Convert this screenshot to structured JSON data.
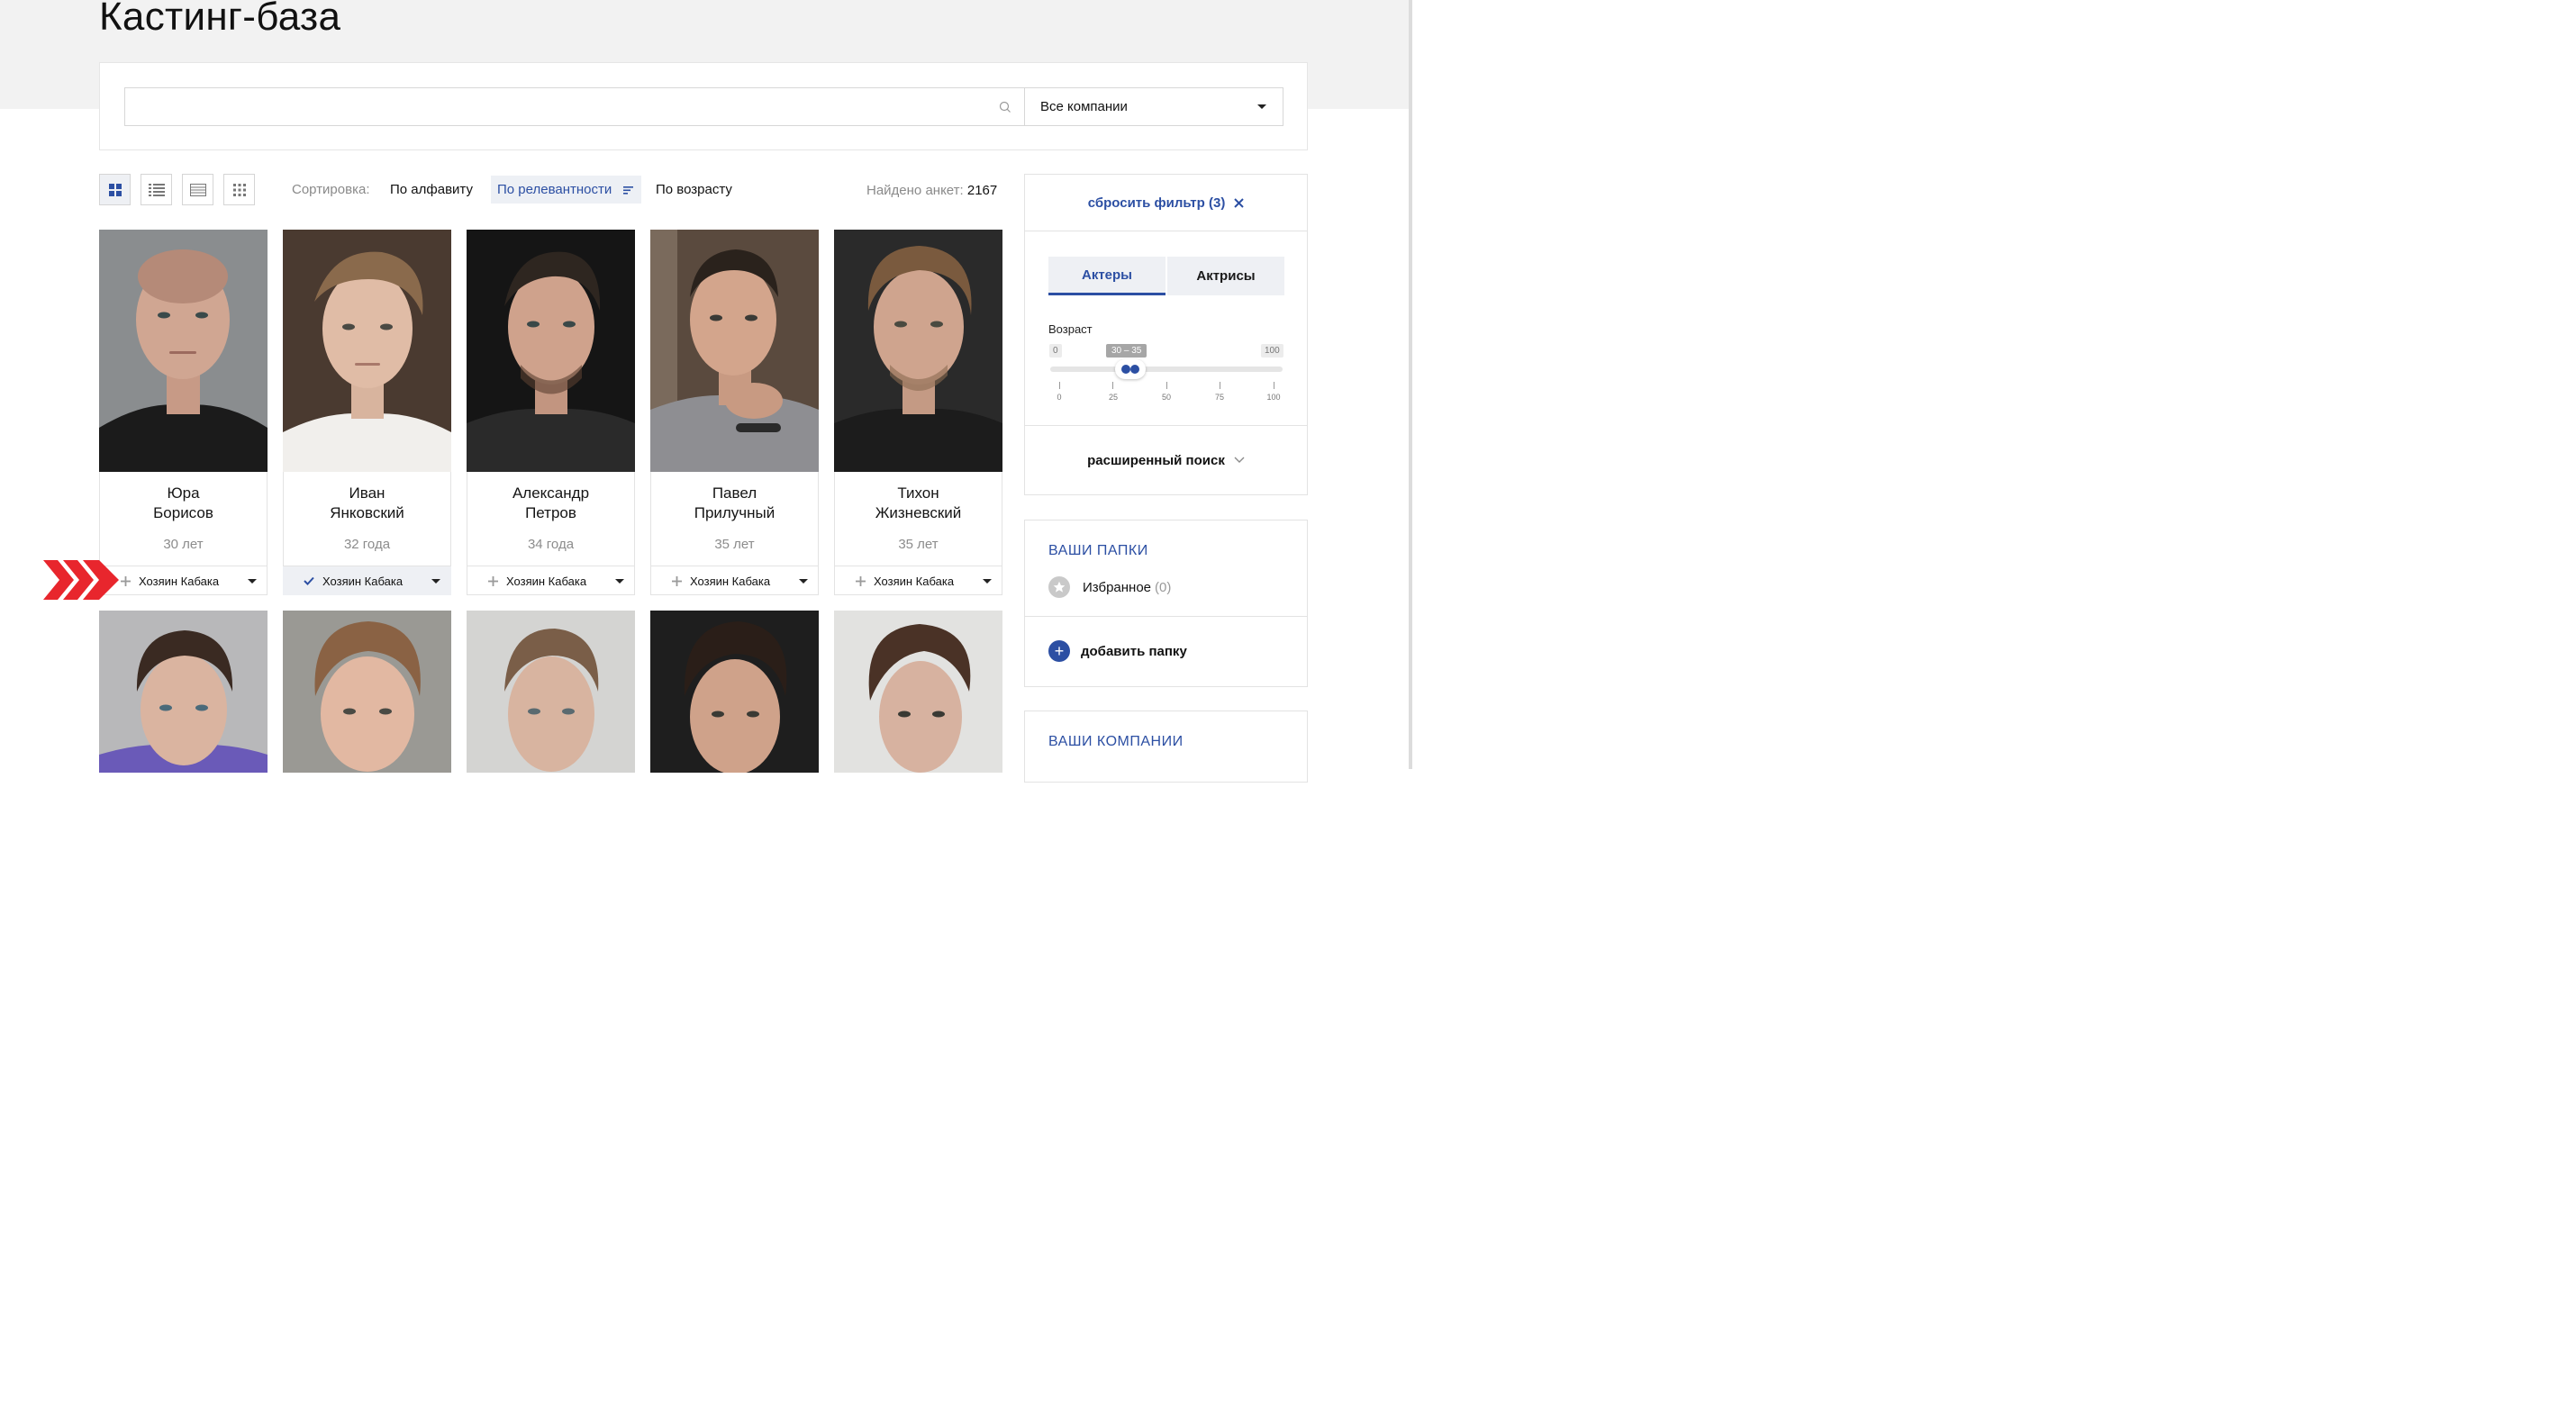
{
  "page": {
    "title": "Кастинг-база"
  },
  "search": {
    "placeholder": "",
    "value": "",
    "company_select": "Все компании"
  },
  "toolbar": {
    "sort_label": "Сортировка:",
    "sort_options": [
      "По алфавиту",
      "По релевантности",
      "По возрасту"
    ],
    "sort_active": "По релевантности",
    "found_label": "Найдено анкет:",
    "found_count": "2167",
    "view_modes": [
      "grid-large-icon",
      "list-icon",
      "table-icon",
      "grid-small-icon"
    ]
  },
  "actors": [
    {
      "name": "Юра\nБорисов",
      "age": "30 лет",
      "company": "Хозяин Кабака",
      "added": false
    },
    {
      "name": "Иван\nЯнковский",
      "age": "32 года",
      "company": "Хозяин Кабака",
      "added": true
    },
    {
      "name": "Александр\nПетров",
      "age": "34 года",
      "company": "Хозяин Кабака",
      "added": false
    },
    {
      "name": "Павел\nПрилучный",
      "age": "35 лет",
      "company": "Хозяин Кабака",
      "added": false
    },
    {
      "name": "Тихон\nЖизневский",
      "age": "35 лет",
      "company": "Хозяин Кабака",
      "added": false
    }
  ],
  "filters": {
    "reset_label": "сбросить фильтр (3)",
    "tabs": [
      "Актеры",
      "Актрисы"
    ],
    "active_tab": "Актеры",
    "age_label": "Возраст",
    "age_min": "0",
    "age_max": "100",
    "age_range": "30 – 35",
    "age_range_values": [
      30,
      35
    ],
    "ticks": [
      "0",
      "25",
      "50",
      "75",
      "100"
    ],
    "advanced_label": "расширенный поиск"
  },
  "folders": {
    "title": "ВАШИ ПАПКИ",
    "items": [
      {
        "label": "Избранное",
        "count": "(0)"
      }
    ],
    "add_label": "добавить папку"
  },
  "companies": {
    "title": "ВАШИ КОМПАНИИ"
  },
  "colors": {
    "accent": "#2c4fa3",
    "marker": "#e8262d",
    "muted": "#8a8a8a"
  }
}
